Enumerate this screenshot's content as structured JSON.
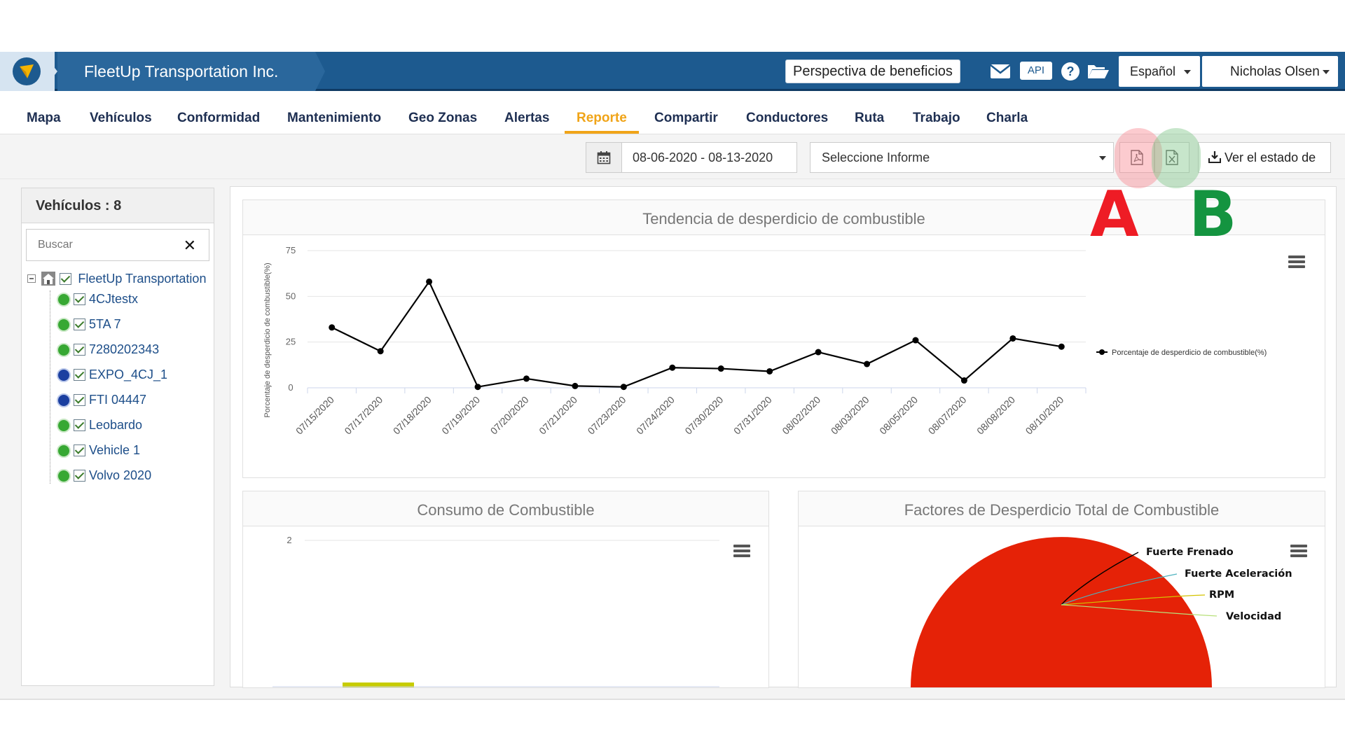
{
  "header": {
    "company": "FleetUp Transportation Inc.",
    "benefits_button": "Perspectiva de beneficios",
    "api_label": "API",
    "language": "Español",
    "user": "Nicholas Olsen"
  },
  "nav": {
    "items": [
      "Mapa",
      "Vehículos",
      "Conformidad",
      "Mantenimiento",
      "Geo Zonas",
      "Alertas",
      "Reporte",
      "Compartir",
      "Conductores",
      "Ruta",
      "Trabajo",
      "Charla"
    ],
    "active": "Reporte"
  },
  "filters": {
    "date_range": "08-06-2020 - 08-13-2020",
    "report_placeholder": "Seleccione Informe",
    "status_button": "Ver el estado de"
  },
  "annotations": {
    "a": "A",
    "b": "B",
    "a_color": "#ee1c25",
    "b_color": "#149440"
  },
  "sidebar": {
    "title": "Vehículos : 8",
    "search_placeholder": "Buscar",
    "root": "FleetUp Transportation",
    "vehicles": [
      {
        "name": "4CJtestx",
        "status": "green"
      },
      {
        "name": "5TA 7",
        "status": "green"
      },
      {
        "name": "7280202343",
        "status": "green"
      },
      {
        "name": "EXPO_4CJ_1",
        "status": "blue"
      },
      {
        "name": "FTI 04447",
        "status": "blue"
      },
      {
        "name": "Leobardo",
        "status": "green"
      },
      {
        "name": "Vehicle 1",
        "status": "green"
      },
      {
        "name": "Volvo 2020",
        "status": "green"
      }
    ]
  },
  "panels": {
    "trend_title": "Tendencia de desperdicio de combustible",
    "consumption_title": "Consumo de Combustible",
    "factors_title": "Factores de Desperdicio Total de Combustible"
  },
  "chart_data": [
    {
      "type": "line",
      "title": "Tendencia de desperdicio de combustible",
      "ylabel": "Porcentaje de desperdicio de combustible(%)",
      "xlabel": "",
      "ylim": [
        0,
        75
      ],
      "yticks": [
        0,
        25,
        50,
        75
      ],
      "categories": [
        "07/15/2020",
        "07/17/2020",
        "07/18/2020",
        "07/19/2020",
        "07/20/2020",
        "07/21/2020",
        "07/23/2020",
        "07/24/2020",
        "07/30/2020",
        "07/31/2020",
        "08/02/2020",
        "08/03/2020",
        "08/05/2020",
        "08/07/2020",
        "08/08/2020",
        "08/10/2020"
      ],
      "series": [
        {
          "name": "Porcentaje de desperdicio de combustible(%)",
          "color": "#000000",
          "values": [
            33,
            20,
            58,
            0.5,
            5,
            1,
            0.5,
            11,
            10.5,
            9,
            19.5,
            13,
            26,
            4,
            27,
            22.5
          ]
        }
      ],
      "legend": "right",
      "grid": true
    },
    {
      "type": "bar",
      "title": "Consumo de Combustible",
      "ylim": [
        0,
        2
      ],
      "yticks": [
        2
      ],
      "series": [
        {
          "color": "#c7cc00"
        }
      ]
    },
    {
      "type": "pie",
      "title": "Factores de Desperdicio Total de Combustible",
      "slices": [
        {
          "label": "Fuerte Frenado",
          "color": "#000000"
        },
        {
          "label": "Fuerte Aceleración",
          "color": "#4fb3bf"
        },
        {
          "label": "RPM",
          "color": "#d4c300"
        },
        {
          "label": "Velocidad",
          "color": "#b8e07a"
        }
      ],
      "fill_color": "#e52207"
    }
  ]
}
